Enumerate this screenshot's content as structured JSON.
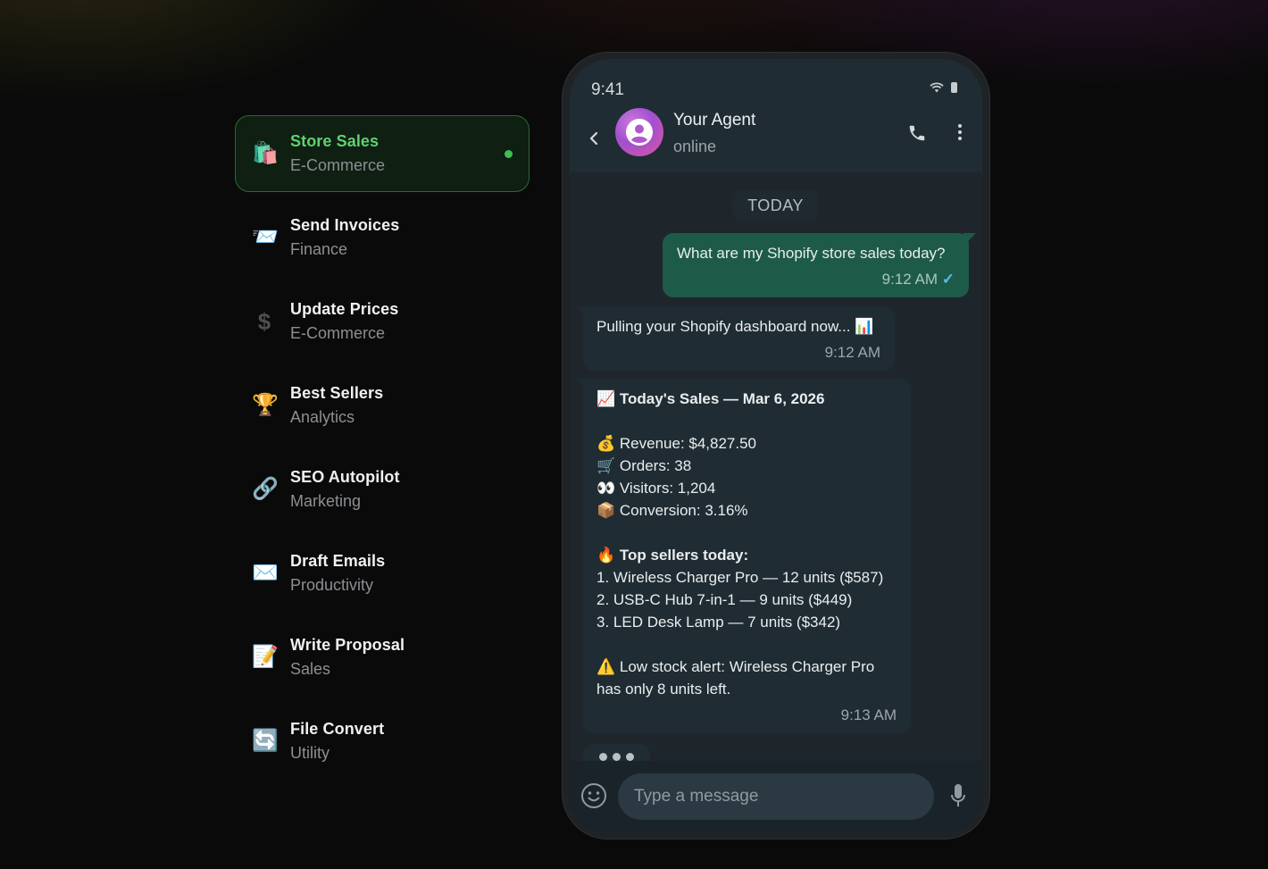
{
  "skills": [
    {
      "icon": "🛍️",
      "title": "Store Sales",
      "subtitle": "E-Commerce",
      "active": true
    },
    {
      "icon": "📨",
      "title": "Send Invoices",
      "subtitle": "Finance"
    },
    {
      "icon": "$",
      "title": "Update Prices",
      "subtitle": "E-Commerce"
    },
    {
      "icon": "🏆",
      "title": "Best Sellers",
      "subtitle": "Analytics"
    },
    {
      "icon": "🔗",
      "title": "SEO Autopilot",
      "subtitle": "Marketing"
    },
    {
      "icon": "✉️",
      "title": "Draft Emails",
      "subtitle": "Productivity"
    },
    {
      "icon": "📝",
      "title": "Write Proposal",
      "subtitle": "Sales"
    },
    {
      "icon": "🔄",
      "title": "File Convert",
      "subtitle": "Utility"
    }
  ],
  "phone": {
    "status_time": "9:41",
    "contact": {
      "name": "Your Agent",
      "status": "online"
    },
    "day_label": "TODAY",
    "messages": {
      "m1": {
        "text": "What are my Shopify store sales today?",
        "time": "9:12 AM",
        "tick": "✓"
      },
      "m2": {
        "text": "Pulling your Shopify dashboard now... 📊",
        "time": "9:12 AM"
      },
      "m3": {
        "heading": "📈 Today's Sales — Mar 6, 2026",
        "stats": [
          "💰 Revenue: $4,827.50",
          "🛒 Orders: 38",
          "👀 Visitors: 1,204",
          "📦 Conversion: 3.16%"
        ],
        "top_heading": "🔥 Top sellers today:",
        "top": [
          "1. Wireless Charger Pro — 12 units ($587)",
          "2. USB-C Hub 7-in-1 — 9 units ($449)",
          "3. LED Desk Lamp — 7 units ($342)"
        ],
        "alert": "⚠️ Low stock alert: Wireless Charger Pro has only 8 units left.",
        "time": "9:13 AM"
      }
    },
    "input_placeholder": "Type a message"
  }
}
